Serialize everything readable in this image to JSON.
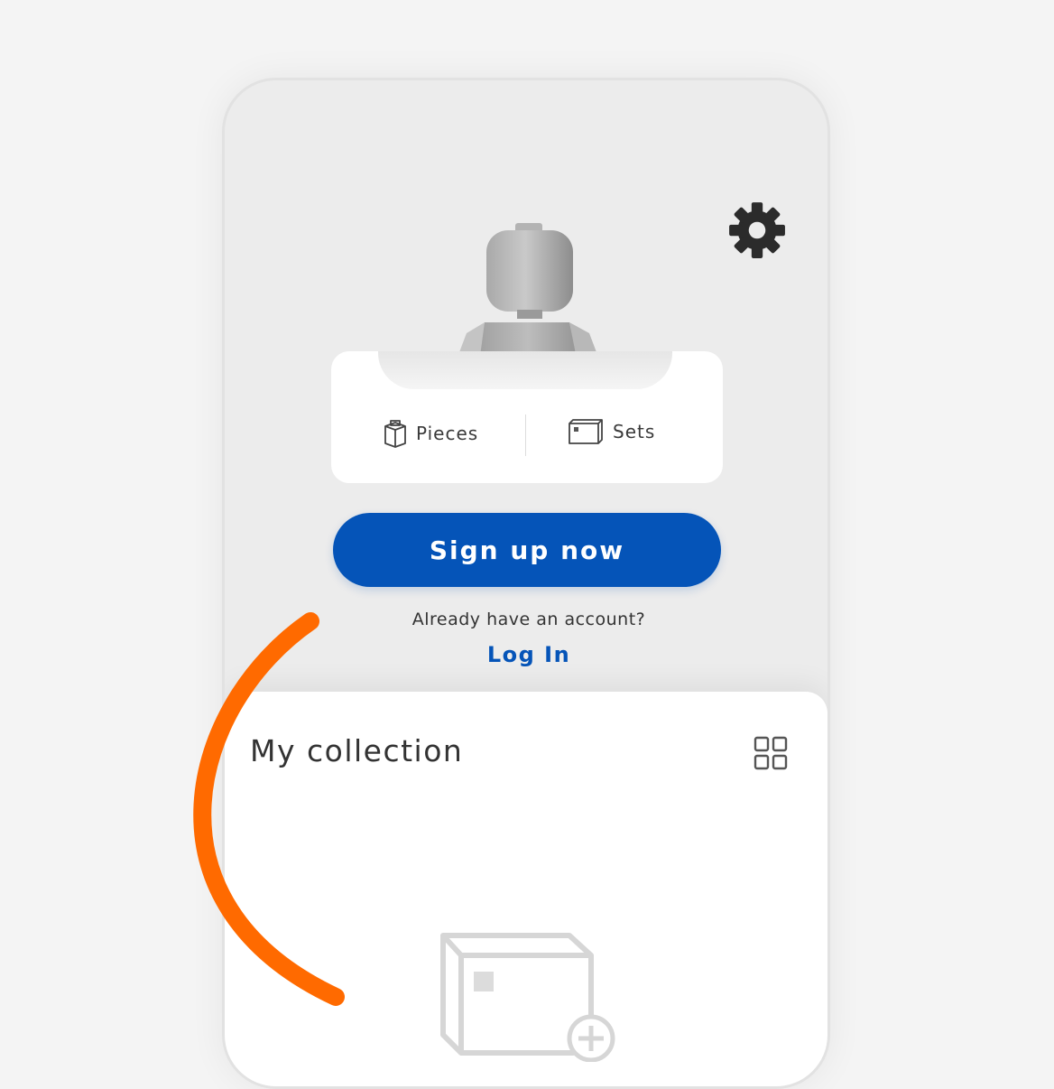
{
  "profile": {
    "stats": {
      "pieces_label": "Pieces",
      "sets_label": "Sets"
    },
    "signup_label": "Sign up now",
    "already_text": "Already have an account?",
    "login_label": "Log In"
  },
  "collection": {
    "title": "My collection"
  },
  "colors": {
    "accent": "#0554b8",
    "annotation": "#ff6a00",
    "background": "#ececec"
  },
  "icons": {
    "settings": "gear-icon",
    "pieces": "brick-icon",
    "sets": "box-icon",
    "view_toggle": "grid-view-icon",
    "empty_state": "add-set-box-icon"
  }
}
